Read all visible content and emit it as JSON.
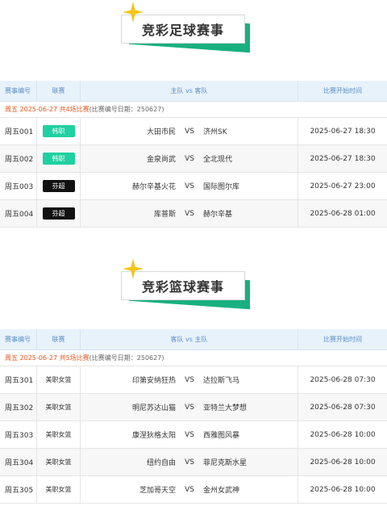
{
  "football": {
    "title": "竞彩足球赛事",
    "headers": {
      "no": "赛事编号",
      "league": "联赛",
      "teams": "主队 vs 客队",
      "time": "比赛开始时间"
    },
    "info_highlight": "周五 2025-06-27 共4场比赛",
    "info_rest": "(比赛编号日期：250627)",
    "vs": "VS",
    "matches": [
      {
        "no": "周五001",
        "league": "韩职",
        "league_style": "green",
        "home": "大田市民",
        "away": "济州SK",
        "time": "2025-06-27 18:30"
      },
      {
        "no": "周五002",
        "league": "韩职",
        "league_style": "green",
        "home": "金泉尚武",
        "away": "全北现代",
        "time": "2025-06-27 18:30"
      },
      {
        "no": "周五003",
        "league": "芬超",
        "league_style": "black",
        "home": "赫尔辛基火花",
        "away": "国际图尔库",
        "time": "2025-06-27 23:00"
      },
      {
        "no": "周五004",
        "league": "芬超",
        "league_style": "black",
        "home": "库普斯",
        "away": "赫尔辛基",
        "time": "2025-06-28 01:00"
      }
    ]
  },
  "basketball": {
    "title": "竞彩篮球赛事",
    "headers": {
      "no": "赛事编号",
      "league": "联赛",
      "teams": "客队 vs 主队",
      "time": "比赛开始时间"
    },
    "info_highlight": "周五 2025-06-27 共5场比赛",
    "info_rest": "(比赛编号日期：250627)",
    "vs": "VS",
    "matches": [
      {
        "no": "周五301",
        "league": "美职女篮",
        "home": "印第安纳狂热",
        "away": "达拉斯飞马",
        "time": "2025-06-28 07:30"
      },
      {
        "no": "周五302",
        "league": "美职女篮",
        "home": "明尼苏达山猫",
        "away": "亚特兰大梦想",
        "time": "2025-06-28 07:30"
      },
      {
        "no": "周五303",
        "league": "美职女篮",
        "home": "康涅狄格太阳",
        "away": "西雅图风暴",
        "time": "2025-06-28 10:00"
      },
      {
        "no": "周五304",
        "league": "美职女篮",
        "home": "纽约自由",
        "away": "菲尼克斯水星",
        "time": "2025-06-28 10:00"
      },
      {
        "no": "周五305",
        "league": "美职女篮",
        "home": "芝加哥天空",
        "away": "金州女武神",
        "time": "2025-06-28 10:00"
      }
    ]
  },
  "colors": {
    "accent_green": "#17b07e",
    "badge_green": "#1fd1a1",
    "header_bg": "#e8f2fb",
    "highlight_orange": "#e35a1f",
    "spark_yellow": "#f5c518"
  }
}
